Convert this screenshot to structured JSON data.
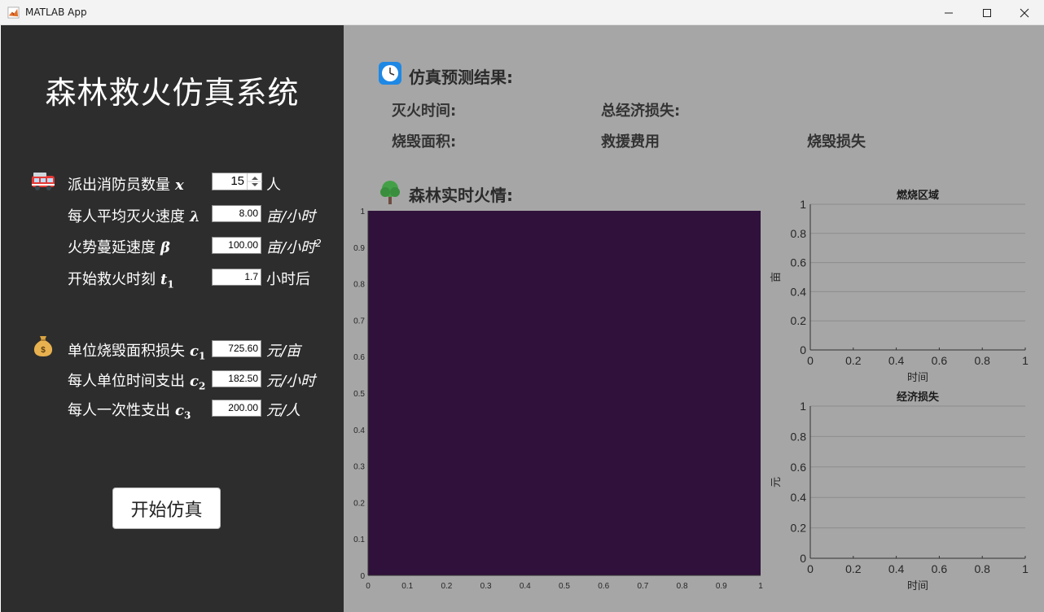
{
  "window": {
    "title": "MATLAB App"
  },
  "left": {
    "heading": "森林救火仿真系统",
    "params": [
      {
        "label": "派出消防员数量",
        "sym": "x",
        "sub": "",
        "value": "15",
        "unit": "人"
      },
      {
        "label": "每人平均灭火速度",
        "sym": "λ",
        "sub": "",
        "value": "8.00",
        "unit": "亩/小时"
      },
      {
        "label": "火势蔓延速度",
        "sym": "β",
        "sub": "",
        "value": "100.00",
        "unit": "亩/小时",
        "unit_sup": "2"
      },
      {
        "label": "开始救火时刻",
        "sym": "t",
        "sub": "1",
        "value": "1.7",
        "unit": "小时后"
      },
      {
        "label": "单位烧毁面积损失",
        "sym": "c",
        "sub": "1",
        "value": "725.60",
        "unit": "元/亩"
      },
      {
        "label": "每人单位时间支出",
        "sym": "c",
        "sub": "2",
        "value": "182.50",
        "unit": "元/小时"
      },
      {
        "label": "每人一次性支出",
        "sym": "c",
        "sub": "3",
        "value": "200.00",
        "unit": "元/人"
      }
    ],
    "start_button": "开始仿真"
  },
  "right": {
    "results_title": "仿真预测结果:",
    "results": {
      "extinguish_time": "灭火时间:",
      "total_loss": "总经济损失:",
      "burned_area": "烧毁面积:",
      "rescue_cost": "救援费用",
      "burn_loss": "烧毁损失"
    },
    "fire_title": "森林实时火情:"
  },
  "chart_data": [
    {
      "type": "heatmap",
      "title": "",
      "xlim": [
        0,
        1
      ],
      "ylim": [
        0,
        1
      ],
      "xticks": [
        "0",
        "0.1",
        "0.2",
        "0.3",
        "0.4",
        "0.5",
        "0.6",
        "0.7",
        "0.8",
        "0.9",
        "1"
      ],
      "yticks": [
        "0",
        "0.1",
        "0.2",
        "0.3",
        "0.4",
        "0.5",
        "0.6",
        "0.7",
        "0.8",
        "0.9",
        "1"
      ],
      "fill_color": "#30113b",
      "values": [
        [
          0
        ]
      ]
    },
    {
      "type": "line",
      "title": "燃烧区域",
      "xlabel": "时间",
      "ylabel": "亩",
      "xlim": [
        0,
        1
      ],
      "ylim": [
        0,
        1
      ],
      "xticks": [
        "0",
        "0.2",
        "0.4",
        "0.6",
        "0.8",
        "1"
      ],
      "yticks": [
        "0",
        "0.2",
        "0.4",
        "0.6",
        "0.8",
        "1"
      ],
      "grid": true,
      "series": []
    },
    {
      "type": "line",
      "title": "经济损失",
      "xlabel": "时间",
      "ylabel": "元",
      "xlim": [
        0,
        1
      ],
      "ylim": [
        0,
        1
      ],
      "xticks": [
        "0",
        "0.2",
        "0.4",
        "0.6",
        "0.8",
        "1"
      ],
      "yticks": [
        "0",
        "0.2",
        "0.4",
        "0.6",
        "0.8",
        "1"
      ],
      "grid": true,
      "series": []
    }
  ],
  "colors": {
    "left_bg": "#2d2d2d",
    "right_bg": "#a6a6a6",
    "heatmap_fill": "#30113b"
  }
}
